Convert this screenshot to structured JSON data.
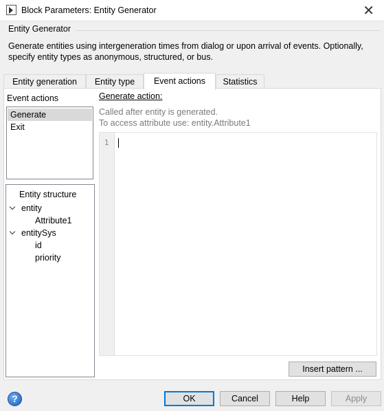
{
  "window": {
    "title": "Block Parameters: Entity Generator",
    "close_glyph": "✕"
  },
  "group": {
    "title": "Entity Generator",
    "description": "Generate entities using intergeneration times from dialog or upon arrival of events. Optionally, specify entity types as anonymous, structured, or bus."
  },
  "tabs": [
    {
      "label": "Entity generation"
    },
    {
      "label": "Entity type"
    },
    {
      "label": "Event actions",
      "active": true
    },
    {
      "label": "Statistics"
    }
  ],
  "event_actions": {
    "label": "Event actions",
    "items": [
      {
        "label": "Generate",
        "selected": true
      },
      {
        "label": "Exit"
      }
    ]
  },
  "entity_structure": {
    "title": "Entity structure",
    "tree": [
      {
        "label": "entity",
        "children": [
          "Attribute1"
        ]
      },
      {
        "label": "entitySys",
        "children": [
          "id",
          "priority"
        ]
      }
    ]
  },
  "action": {
    "label": "Generate action:",
    "hint_line1": "Called after entity is generated.",
    "hint_line2": "To access attribute use: entity.Attribute1",
    "editor": {
      "line_number": "1",
      "content": ""
    }
  },
  "buttons": {
    "insert_pattern": "Insert pattern ...",
    "ok": "OK",
    "cancel": "Cancel",
    "help": "Help",
    "apply": "Apply"
  },
  "help_icon_glyph": "?",
  "colors": {
    "accent": "#0078d7",
    "selected_item": "#d9d9d9",
    "hint_text": "#7a7a7a"
  }
}
